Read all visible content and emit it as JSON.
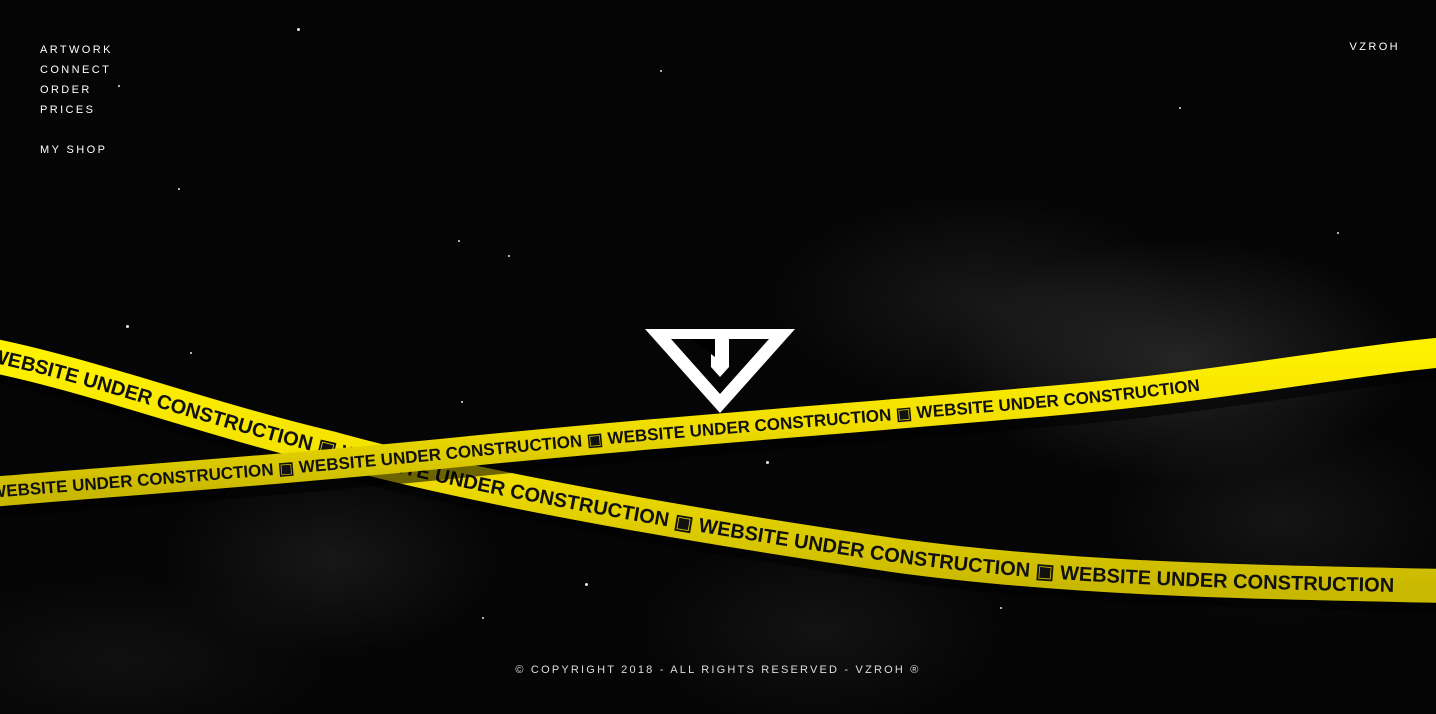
{
  "nav": {
    "items": [
      {
        "label": "ARTWORK"
      },
      {
        "label": "CONNECT"
      },
      {
        "label": "ORDER"
      },
      {
        "label": "PRICES"
      }
    ],
    "shop": {
      "label": "MY SHOP"
    }
  },
  "brand": {
    "label": "VZROH"
  },
  "logo": {
    "icon": "vzroh-logo-icon",
    "color": "#ffffff"
  },
  "tape": {
    "text": "WEBSITE UNDER CONSTRUCTION",
    "color": "#f5e400",
    "text_color": "#111111"
  },
  "footer": {
    "copyright": "© COPYRIGHT 2018 - ALL RIGHTS RESERVED - VZROH ®"
  }
}
